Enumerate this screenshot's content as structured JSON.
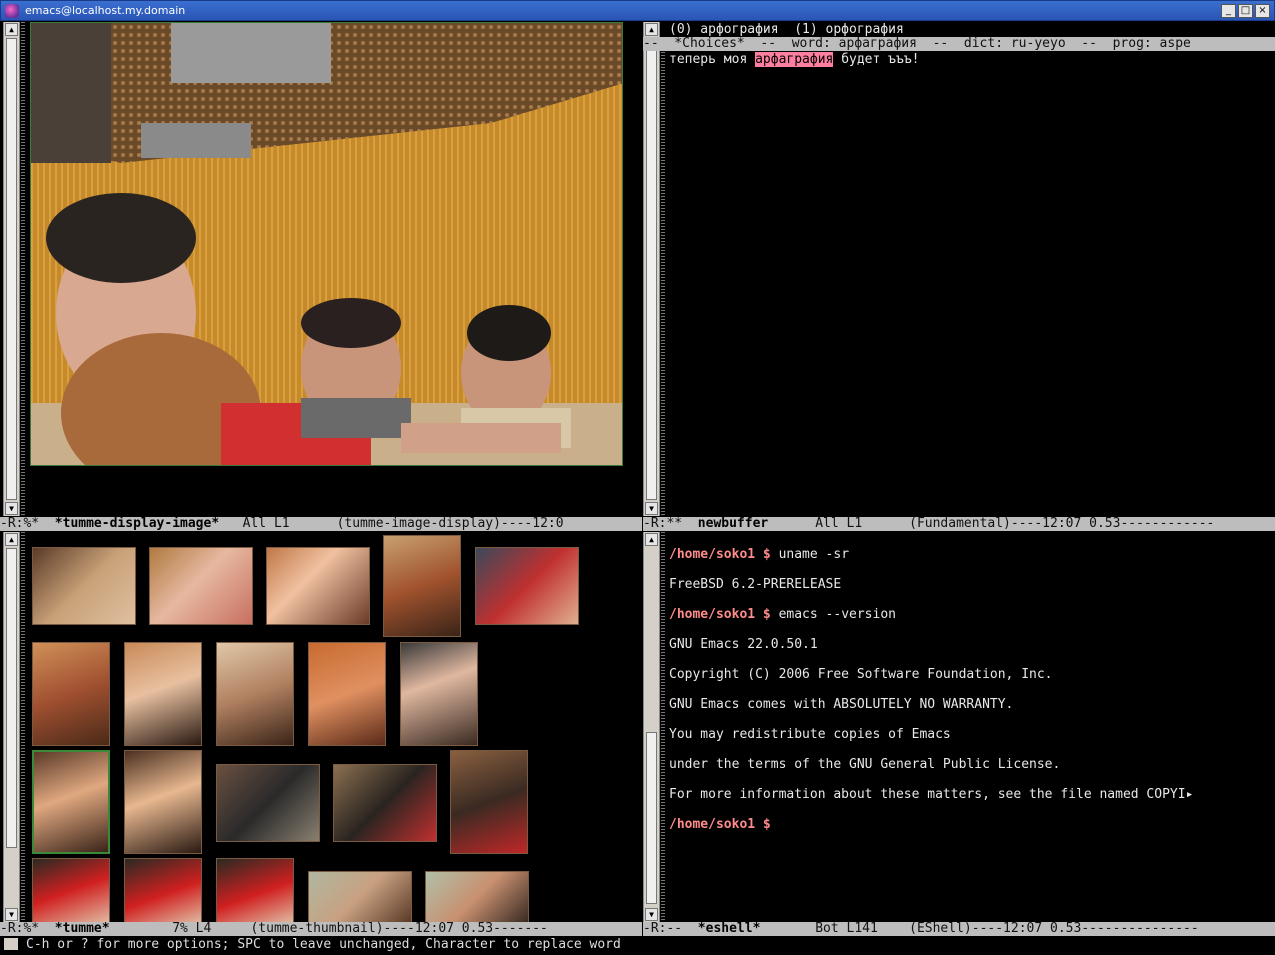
{
  "window": {
    "title": "emacs@localhost.my.domain",
    "btn_min": "_",
    "btn_max": "□",
    "btn_close": "×"
  },
  "choices_pane": {
    "line1": "(0) арфогpафия  (1) орфография",
    "modeline": "--  *Choices*  --  word: арфагpафия  --  dict: ru-yeyo  --  prog: aspe",
    "text_before": "теперь моя ",
    "text_highlight": "арфагpафия",
    "text_after": " будет ъъъ!"
  },
  "modeline_top_left": {
    "flags": "-R:%*  ",
    "buffer": "*tumme-display-image*",
    "rest": "   All L1      (tumme-image-display)----12:0"
  },
  "modeline_top_right": {
    "flags": "-R:**  ",
    "buffer": "newbuffer",
    "rest": "      All L1      (Fundamental)----12:07 0.53------------"
  },
  "modeline_bottom_left": {
    "flags": "-R:%*  ",
    "buffer": "*tumme*",
    "rest": "        7% L4     (tumme-thumbnail)----12:07 0.53-------"
  },
  "modeline_bottom_right": {
    "flags": "-R:--  ",
    "buffer": "*eshell*",
    "rest": "       Bot L141    (EShell)----12:07 0.53---------------"
  },
  "eshell": {
    "prompt1": "/home/soko1 $",
    "cmd1": " uname -sr",
    "out1": "FreeBSD 6.2-PRERELEASE",
    "prompt2": "/home/soko1 $",
    "cmd2": " emacs --version",
    "out2": "GNU Emacs 22.0.50.1",
    "out3": "Copyright (C) 2006 Free Software Foundation, Inc.",
    "out4": "GNU Emacs comes with ABSOLUTELY NO WARRANTY.",
    "out5": "You may redistribute copies of Emacs",
    "out6": "under the terms of the GNU General Public License.",
    "out7": "For more information about these matters, see the file named COPYI",
    "trunc": "▸",
    "prompt3": "/home/soko1 $"
  },
  "echo_area": "C-h or ? for more options; SPC to leave unchanged, Character to replace word",
  "colors": {
    "modeline_bg": "#bdbdbd",
    "prompt": "#ff8b8b",
    "highlight": "#ff7fa0"
  }
}
